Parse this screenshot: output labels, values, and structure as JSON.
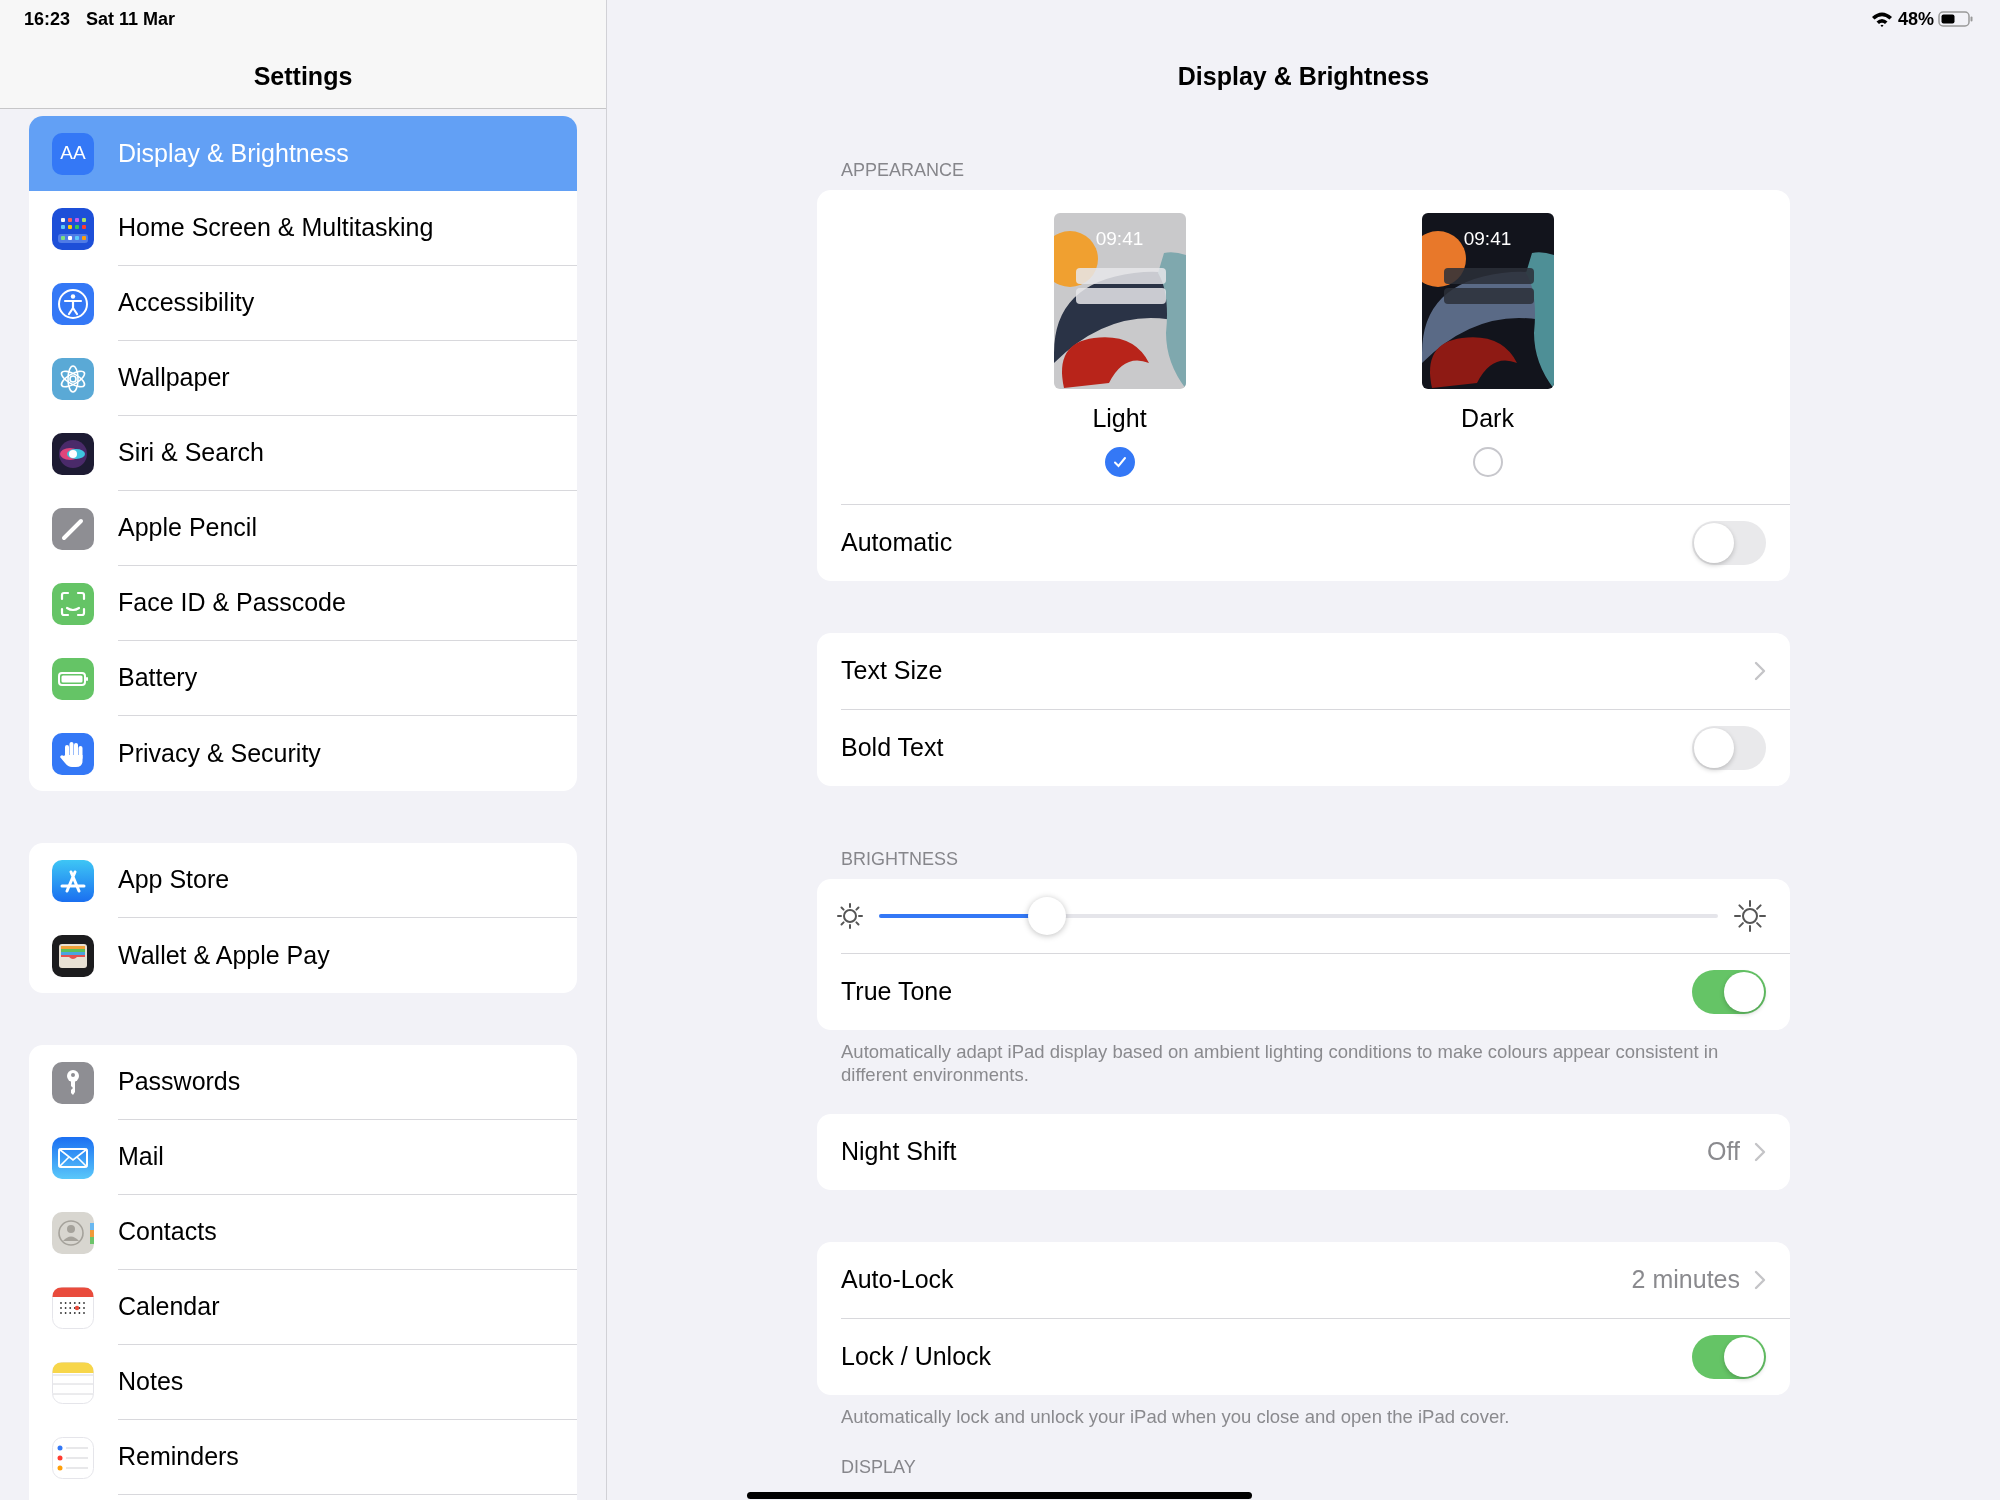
{
  "status_bar": {
    "time": "16:23",
    "date": "Sat 11 Mar",
    "battery": "48%"
  },
  "sidebar": {
    "title": "Settings",
    "groups": [
      {
        "items": [
          {
            "label": "Display & Brightness",
            "icon_text": "AA",
            "selected": true
          },
          {
            "label": "Home Screen & Multitasking",
            "selected": false
          },
          {
            "label": "Accessibility",
            "selected": false
          },
          {
            "label": "Wallpaper",
            "selected": false
          },
          {
            "label": "Siri & Search",
            "selected": false
          },
          {
            "label": "Apple Pencil",
            "selected": false
          },
          {
            "label": "Face ID & Passcode",
            "selected": false
          },
          {
            "label": "Battery",
            "selected": false
          },
          {
            "label": "Privacy & Security",
            "selected": false
          }
        ]
      },
      {
        "items": [
          {
            "label": "App Store",
            "selected": false
          },
          {
            "label": "Wallet & Apple Pay",
            "selected": false
          }
        ]
      },
      {
        "items": [
          {
            "label": "Passwords",
            "selected": false
          },
          {
            "label": "Mail",
            "selected": false
          },
          {
            "label": "Contacts",
            "selected": false
          },
          {
            "label": "Calendar",
            "selected": false
          },
          {
            "label": "Notes",
            "selected": false
          },
          {
            "label": "Reminders",
            "selected": false
          }
        ]
      }
    ]
  },
  "detail": {
    "title": "Display & Brightness",
    "sections": [
      {
        "header": "APPEARANCE",
        "rows": [
          {
            "kind": "appearance",
            "options": [
              {
                "label": "Light",
                "kind": "light",
                "time": "09:41",
                "selected": true
              },
              {
                "label": "Dark",
                "kind": "dark",
                "time": "09:41",
                "selected": false
              }
            ]
          },
          {
            "kind": "toggle",
            "label": "Automatic",
            "on": false
          }
        ]
      },
      {
        "rows": [
          {
            "kind": "disclosure",
            "label": "Text Size"
          },
          {
            "kind": "toggle",
            "label": "Bold Text",
            "on": false
          }
        ]
      },
      {
        "header": "BRIGHTNESS",
        "rows": [
          {
            "kind": "slider",
            "level": 0.2
          },
          {
            "kind": "toggle",
            "label": "True Tone",
            "on": true
          }
        ],
        "footer": "Automatically adapt iPad display based on ambient lighting conditions to make colours appear consistent in different environments."
      },
      {
        "rows": [
          {
            "kind": "disclosure",
            "label": "Night Shift",
            "value": "Off"
          }
        ]
      },
      {
        "rows": [
          {
            "kind": "disclosure",
            "label": "Auto-Lock",
            "value": "2 minutes"
          },
          {
            "kind": "toggle",
            "label": "Lock / Unlock",
            "on": true
          }
        ],
        "footer": "Automatically lock and unlock your iPad when you close and open the iPad cover."
      },
      {
        "header": "DISPLAY"
      }
    ]
  }
}
